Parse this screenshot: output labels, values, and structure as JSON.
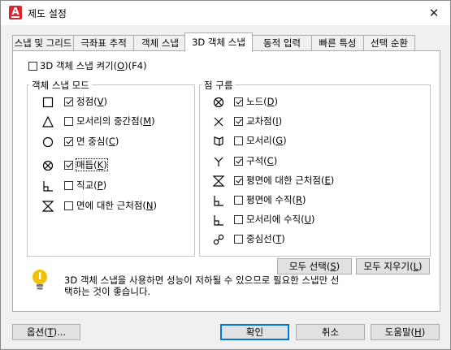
{
  "window": {
    "title": "제도 설정",
    "close_glyph": "✕"
  },
  "tabs": [
    {
      "label": "스냅 및 그리드"
    },
    {
      "label": "극좌표 추적"
    },
    {
      "label": "객체 스냅"
    },
    {
      "label": "3D 객체 스냅"
    },
    {
      "label": "동적 입력"
    },
    {
      "label": "빠른 특성"
    },
    {
      "label": "선택 순환"
    }
  ],
  "active_tab": "3D 객체 스냅",
  "toggle": {
    "checked": false,
    "text_a": "3D 객체 스냅 켜기(",
    "mnemonic": "O",
    "text_b": ")(F4)"
  },
  "object_modes": {
    "title": "객체 스냅 모드",
    "items": [
      {
        "a": "정점(",
        "m": "V",
        "b": ")",
        "checked": true,
        "icon": "vertex-square-icon"
      },
      {
        "a": "모서리의 중간점(",
        "m": "M",
        "b": ")",
        "checked": false,
        "icon": "midpoint-triangle-icon"
      },
      {
        "a": "면 중심(",
        "m": "C",
        "b": ")",
        "checked": true,
        "icon": "face-center-circle-icon"
      },
      {
        "a": "매듭(",
        "m": "K",
        "b": ")",
        "checked": true,
        "icon": "knot-circle-x-icon",
        "focused": true
      },
      {
        "a": "직교(",
        "m": "P",
        "b": ")",
        "checked": false,
        "icon": "perpendicular-icon"
      },
      {
        "a": "면에 대한 근처점(",
        "m": "N",
        "b": ")",
        "checked": false,
        "icon": "nearest-face-icon"
      }
    ]
  },
  "point_cloud": {
    "title": "점 구름",
    "items": [
      {
        "a": "노드(",
        "m": "D",
        "b": ")",
        "checked": true,
        "icon": "node-circle-x-icon"
      },
      {
        "a": "교차점(",
        "m": "I",
        "b": ")",
        "checked": true,
        "icon": "intersection-x-icon"
      },
      {
        "a": "모서리(",
        "m": "G",
        "b": ")",
        "checked": false,
        "icon": "edge-icon"
      },
      {
        "a": "구석(",
        "m": "C",
        "b": ")",
        "checked": true,
        "icon": "corner-y-icon"
      },
      {
        "a": "평면에 대한 근처점(",
        "m": "E",
        "b": ")",
        "checked": true,
        "icon": "nearest-plane-icon"
      },
      {
        "a": "평면에 수직(",
        "m": "R",
        "b": ")",
        "checked": false,
        "icon": "perpendicular-plane-icon"
      },
      {
        "a": "모서리에 수직(",
        "m": "U",
        "b": ")",
        "checked": false,
        "icon": "perpendicular-edge-icon"
      },
      {
        "a": "중심선(",
        "m": "T",
        "b": ")",
        "checked": false,
        "icon": "centerline-icon"
      }
    ]
  },
  "buttons": {
    "select_all": {
      "a": "모두 선택(",
      "m": "S",
      "b": ")"
    },
    "clear_all": {
      "a": "모두 지우기(",
      "m": "L",
      "b": ")"
    },
    "options": {
      "a": "옵션(",
      "m": "T",
      "b": ")..."
    },
    "ok": {
      "label": "확인"
    },
    "cancel": {
      "label": "취소"
    },
    "help": {
      "a": "도움말(",
      "m": "H",
      "b": ")"
    }
  },
  "info": {
    "line1": "3D 객체 스냅을 사용하면 성능이 저하될 수 있으므로 필요한 스냅만 선",
    "line2": "택하는 것이 좋습니다."
  },
  "colors": {
    "accent": "#0078d7",
    "app_red": "#d9252f",
    "bulb": "#f2c200"
  }
}
